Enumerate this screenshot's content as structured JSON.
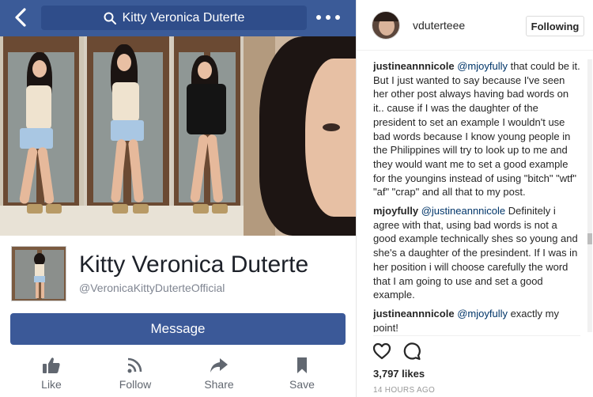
{
  "colors": {
    "facebook_blue": "#3b5b98",
    "message_button": "#3b5998",
    "text_dark": "#1d2129",
    "text_muted": "#7f8591",
    "instagram_text": "#262626",
    "instagram_link": "#003569"
  },
  "facebook": {
    "search_query": "Kitty Veronica Duterte",
    "icons": {
      "back": "chevron-left-icon",
      "search": "search-icon",
      "more": "more-dots-icon"
    },
    "page_name": "Kitty Veronica Duterte",
    "page_handle": "@VeronicaKittyDuterteOfficial",
    "message_label": "Message",
    "actions": [
      {
        "label": "Like",
        "icon": "thumbs-up-icon"
      },
      {
        "label": "Follow",
        "icon": "rss-icon"
      },
      {
        "label": "Share",
        "icon": "share-arrow-icon"
      },
      {
        "label": "Save",
        "icon": "bookmark-icon"
      }
    ]
  },
  "instagram": {
    "username": "vduterteee",
    "follow_label": "Following",
    "comments": [
      {
        "user": "justineannnicole",
        "mention": "@mjoyfully",
        "text": " that could be it. But I just wanted to say because I've seen her other post always having bad words on it.. cause if I was the daughter of the president to set an example I wouldn't use bad words because I know young people in the Philippines will try to look up to me and they would want me to set a good example for the youngins instead of using \"bitch\" \"wtf\" \"af\" \"crap\" and all that to my post."
      },
      {
        "user": "mjoyfully",
        "mention": "@justineannnicole",
        "text": " Definitely i agree with that, using bad words is not a good example technically shes so young and she's a daughter of the presindent. If I was in her position i will choose carefully the word that I am going to use and set a good example."
      },
      {
        "user": "justineannnicole",
        "mention": "@mjoyfully",
        "text": " exactly my point!"
      }
    ],
    "icons": {
      "like": "heart-icon",
      "comment": "comment-bubble-icon"
    },
    "likes": "3,797 likes",
    "timestamp": "14 HOURS AGO"
  }
}
